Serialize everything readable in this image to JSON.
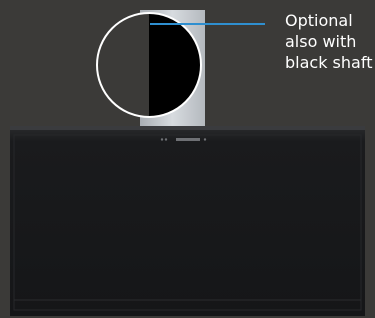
{
  "annotation": {
    "lines": [
      "Optional",
      "also with",
      "black shaft"
    ],
    "line_color": "#2f8fd0"
  },
  "colors": {
    "background": "#3b3a38",
    "hood": "#1c1d1f",
    "shaft_steel": "#c9cdd2",
    "shaft_black": "#000000"
  }
}
